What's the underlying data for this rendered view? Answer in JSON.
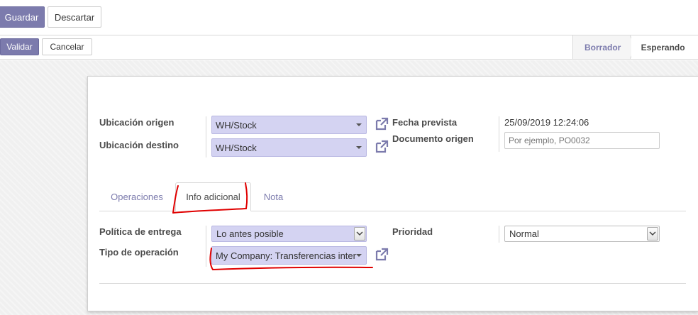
{
  "control_panel": {
    "save_label": "Guardar",
    "discard_label": "Descartar"
  },
  "status_bar": {
    "validate_label": "Validar",
    "cancel_label": "Cancelar",
    "stages": [
      "Borrador",
      "Esperando"
    ],
    "active_stage": "Esperando"
  },
  "form": {
    "source_location_label": "Ubicación origen",
    "source_location_value": "WH/Stock",
    "dest_location_label": "Ubicación destino",
    "dest_location_value": "WH/Stock",
    "scheduled_date_label": "Fecha prevista",
    "scheduled_date_value": "25/09/2019 12:24:06",
    "source_doc_label": "Documento origen",
    "source_doc_placeholder": "Por ejemplo, PO0032"
  },
  "tabs": [
    {
      "label": "Operaciones",
      "active": false
    },
    {
      "label": "Info adicional",
      "active": true
    },
    {
      "label": "Nota",
      "active": false
    }
  ],
  "additional_info": {
    "delivery_policy_label": "Política de entrega",
    "delivery_policy_value": "Lo antes posible",
    "operation_type_label": "Tipo de operación",
    "operation_type_value": "My Company: Transferencias inter",
    "priority_label": "Prioridad",
    "priority_value": "Normal"
  },
  "colors": {
    "primary": "#7c7bad",
    "many2one_bg": "#d4d3f2",
    "annotation_red": "#e00000"
  },
  "icons": [
    "external-link-icon",
    "caret-down-icon",
    "select-arrow-icon"
  ]
}
